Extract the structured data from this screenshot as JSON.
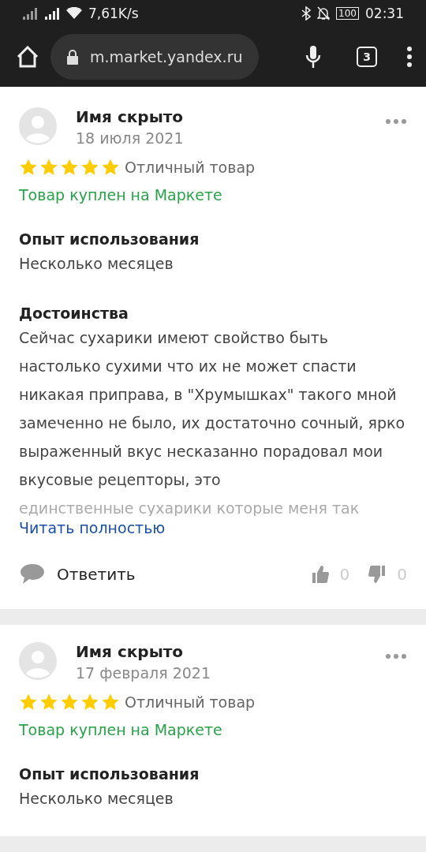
{
  "status_bar": {
    "speed": "7,61K/s",
    "battery": "100",
    "time": "02:31"
  },
  "browser": {
    "url": "m.market.yandex.ru",
    "tabs_count": "3"
  },
  "reviews": [
    {
      "author": "Имя скрыто",
      "date": "18 июля 2021",
      "stars": 5,
      "rating_text": "Отличный товар",
      "purchase": "Товар куплен на Маркете",
      "sections": [
        {
          "title": "Опыт использования",
          "text": "Несколько месяцев"
        },
        {
          "title": "Достоинства",
          "text": "Сейчас сухарики имеют свойство быть настолько сухими что их не может спасти никакая приправа, в \"Хрумышках\" такого мной замеченно не было,  их достаточно сочный, ярко выраженный вкус несказанно порадовал мои вкусовые рецепторы, это",
          "faded": "единственные сухарики которые меня так"
        }
      ],
      "read_more": "Читать полностью",
      "reply": "Ответить",
      "likes": "0",
      "dislikes": "0"
    },
    {
      "author": "Имя скрыто",
      "date": "17 февраля 2021",
      "stars": 5,
      "rating_text": "Отличный товар",
      "purchase": "Товар куплен на Маркете",
      "sections": [
        {
          "title": "Опыт использования",
          "text": "Несколько месяцев"
        }
      ]
    }
  ]
}
